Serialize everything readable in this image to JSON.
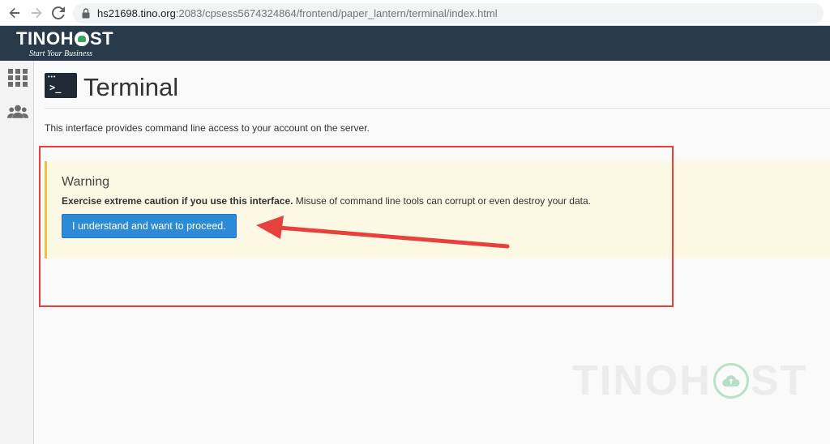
{
  "browser": {
    "url_host": "hs21698.tino.org",
    "url_rest": ":2083/cpsess5674324864/frontend/paper_lantern/terminal/index.html"
  },
  "header": {
    "logo_left": "TINO",
    "logo_right": "ST",
    "logo_h": "H",
    "tagline": "Start Your Business"
  },
  "page": {
    "title": "Terminal",
    "description": "This interface provides command line access to your account on the server."
  },
  "warning": {
    "title": "Warning",
    "bold_text": "Exercise extreme caution if you use this interface.",
    "text": " Misuse of command line tools can corrupt or even destroy your data.",
    "button_label": "I understand and want to proceed."
  },
  "watermark": {
    "left": "TINOH",
    "right": "ST"
  },
  "colors": {
    "header_bg": "#293a4a",
    "button_bg": "#2d8ad6",
    "warning_bg": "#fcf8e3",
    "annotation": "#e8403c"
  },
  "icons": {
    "back": "arrow-left-icon",
    "forward": "arrow-right-icon",
    "reload": "reload-icon",
    "lock": "lock-icon",
    "apps": "grid-icon",
    "users": "users-icon",
    "terminal": "terminal-icon"
  }
}
